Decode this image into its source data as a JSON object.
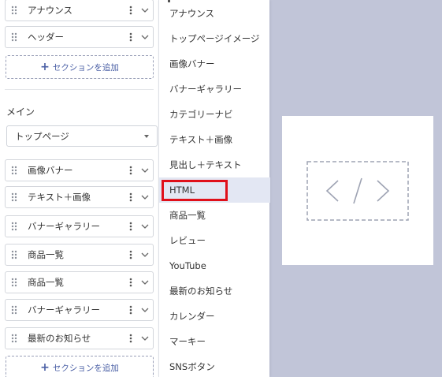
{
  "sections": {
    "header_rows": [
      {
        "label": "アナウンス"
      },
      {
        "label": "ヘッダー"
      }
    ],
    "add_section_label": "セクションを追加",
    "main_title": "メイン",
    "page_select_value": "トップページ",
    "main_rows": [
      {
        "label": "画像バナー"
      },
      {
        "label": "テキスト＋画像"
      },
      {
        "label": "バナーギャラリー"
      },
      {
        "label": "商品一覧"
      },
      {
        "label": "商品一覧"
      },
      {
        "label": "バナーギャラリー"
      },
      {
        "label": "最新のお知らせ"
      }
    ]
  },
  "menu": {
    "items": [
      {
        "label": "アナウンス"
      },
      {
        "label": "トップページイメージ"
      },
      {
        "label": "画像バナー"
      },
      {
        "label": "バナーギャラリー"
      },
      {
        "label": "カテゴリーナビ"
      },
      {
        "label": "テキスト＋画像"
      },
      {
        "label": "見出し＋テキスト"
      },
      {
        "label": "HTML"
      },
      {
        "label": "商品一覧"
      },
      {
        "label": "レビュー"
      },
      {
        "label": "YouTube"
      },
      {
        "label": "最新のお知らせ"
      },
      {
        "label": "カレンダー"
      },
      {
        "label": "マーキー"
      },
      {
        "label": "SNSボタン"
      }
    ],
    "selected": "HTML"
  },
  "preview": {
    "icon": "code-icon"
  },
  "colors": {
    "accent": "#4a5fa5",
    "highlight_border": "#e0101a",
    "menu_active_bg": "#e3e7f3",
    "preview_bg": "#c1c5d8"
  }
}
